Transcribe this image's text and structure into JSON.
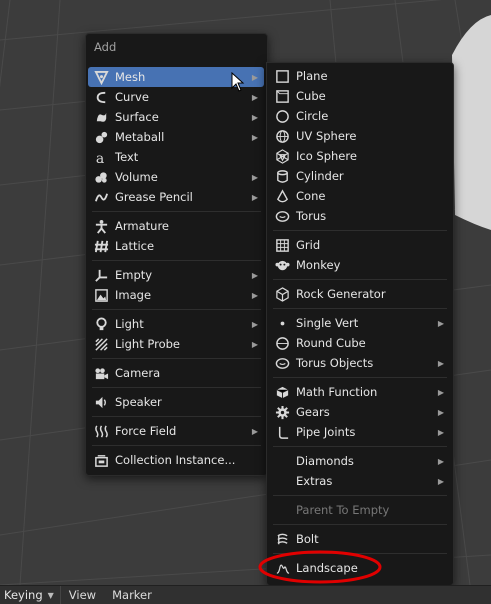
{
  "add_menu": {
    "title": "Add",
    "items": [
      {
        "label": "Mesh",
        "icon": "mesh-icon",
        "submenu": true,
        "active": true
      },
      {
        "label": "Curve",
        "icon": "curve-icon",
        "submenu": true
      },
      {
        "label": "Surface",
        "icon": "surface-icon",
        "submenu": true
      },
      {
        "label": "Metaball",
        "icon": "metaball-icon",
        "submenu": true
      },
      {
        "label": "Text",
        "icon": "text-icon",
        "submenu": false
      },
      {
        "label": "Volume",
        "icon": "volume-icon",
        "submenu": true
      },
      {
        "label": "Grease Pencil",
        "icon": "grease-pencil-icon",
        "submenu": true
      },
      {
        "label": "Armature",
        "icon": "armature-icon",
        "submenu": false
      },
      {
        "label": "Lattice",
        "icon": "lattice-icon",
        "submenu": false
      },
      {
        "label": "Empty",
        "icon": "empty-icon",
        "submenu": true
      },
      {
        "label": "Image",
        "icon": "image-icon",
        "submenu": true
      },
      {
        "label": "Light",
        "icon": "light-icon",
        "submenu": true
      },
      {
        "label": "Light Probe",
        "icon": "light-probe-icon",
        "submenu": true
      },
      {
        "label": "Camera",
        "icon": "camera-icon",
        "submenu": false
      },
      {
        "label": "Speaker",
        "icon": "speaker-icon",
        "submenu": false
      },
      {
        "label": "Force Field",
        "icon": "force-field-icon",
        "submenu": true
      },
      {
        "label": "Collection Instance...",
        "icon": "collection-icon",
        "submenu": false
      }
    ]
  },
  "mesh_menu": {
    "items": [
      {
        "label": "Plane",
        "icon": "plane-icon",
        "submenu": false
      },
      {
        "label": "Cube",
        "icon": "cube-icon",
        "submenu": false
      },
      {
        "label": "Circle",
        "icon": "circle-icon",
        "submenu": false
      },
      {
        "label": "UV Sphere",
        "icon": "uv-sphere-icon",
        "submenu": false
      },
      {
        "label": "Ico Sphere",
        "icon": "ico-sphere-icon",
        "submenu": false
      },
      {
        "label": "Cylinder",
        "icon": "cylinder-icon",
        "submenu": false
      },
      {
        "label": "Cone",
        "icon": "cone-icon",
        "submenu": false
      },
      {
        "label": "Torus",
        "icon": "torus-icon",
        "submenu": false
      },
      {
        "label": "Grid",
        "icon": "grid-icon",
        "submenu": false
      },
      {
        "label": "Monkey",
        "icon": "monkey-icon",
        "submenu": false
      },
      {
        "label": "Rock Generator",
        "icon": "rock-generator-icon",
        "submenu": false
      },
      {
        "label": "Single Vert",
        "icon": "single-vert-icon",
        "submenu": true
      },
      {
        "label": "Round Cube",
        "icon": "round-cube-icon",
        "submenu": false
      },
      {
        "label": "Torus Objects",
        "icon": "torus-objects-icon",
        "submenu": true
      },
      {
        "label": "Math Function",
        "icon": "math-function-icon",
        "submenu": true
      },
      {
        "label": "Gears",
        "icon": "gears-icon",
        "submenu": true
      },
      {
        "label": "Pipe Joints",
        "icon": "pipe-joints-icon",
        "submenu": true
      },
      {
        "label": "Diamonds",
        "icon": "",
        "submenu": true
      },
      {
        "label": "Extras",
        "icon": "",
        "submenu": true
      },
      {
        "label": "Parent To Empty",
        "icon": "",
        "submenu": false,
        "disabled": true
      },
      {
        "label": "Bolt",
        "icon": "bolt-icon",
        "submenu": false
      },
      {
        "label": "Landscape",
        "icon": "landscape-icon",
        "submenu": false,
        "circled": true
      }
    ]
  },
  "header": {
    "keying": "Keying",
    "view": "View",
    "marker": "Marker"
  },
  "colors": {
    "accent": "#4772b3",
    "menu_bg": "#181818",
    "annotation": "#e00000"
  }
}
